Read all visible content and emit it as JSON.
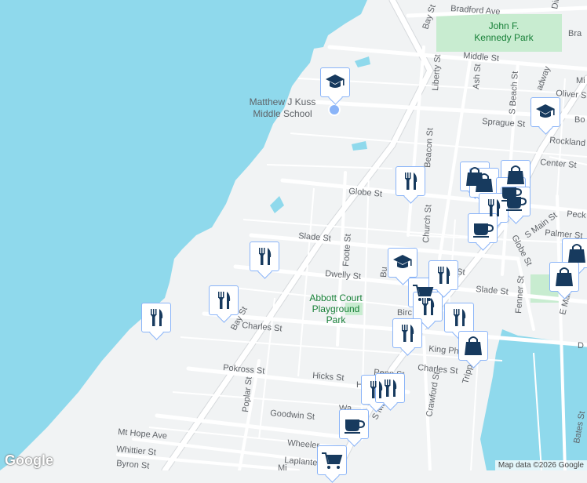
{
  "map": {
    "colors": {
      "water": "#8fd9ec",
      "land": "#f1f3f4",
      "park": "#c8ecd0",
      "road": "#ffffff",
      "road_casing": "#d6d9dc",
      "marker_icon": "#173a5e",
      "school_label": "#5f6368",
      "park_label": "#188038"
    },
    "streets": {
      "bradford_ave": "Bradford Ave",
      "bay_st_top": "Bay St",
      "middle_st": "Middle St",
      "sprague_st": "Sprague St",
      "globe_st": "Globe St",
      "slade_st": "Slade St",
      "dwelly_st": "Dwelly St",
      "charles_st": "Charles St",
      "bay_st_bottom": "Bay St",
      "pokross_st": "Pokross St",
      "hicks_st": "Hicks St",
      "goodwin_st": "Goodwin St",
      "mt_hope_ave": "Mt Hope Ave",
      "whittier_st": "Whittier St",
      "byron_st": "Byron St",
      "wheeler": "Wheeler",
      "laplante": "Laplante",
      "poplar_st": "Poplar St",
      "foote_st": "Foote St",
      "liberty_st": "Liberty St",
      "beacon_st": "Beacon St",
      "church_st": "Church St",
      "ash_st": "Ash St",
      "s_beach_st": "S Beach St",
      "oliver_st": "Oliver St",
      "rockland_st": "Rockland St",
      "center_st": "Center St",
      "peck": "Peck",
      "palmer_st": "Palmer St",
      "s_main_st_upper": "S Main St",
      "globe_st_east": "Globe St",
      "hall_st": "Hall St",
      "slade_st_east": "Slade St",
      "fenner_st": "Fenner St",
      "e_main_st": "E Main St",
      "king_phil": "King Phil",
      "birc": "Birc",
      "charles_st_east": "Charles St",
      "penn_st": "Penn St",
      "crawford_st": "Crawford St",
      "tripp_st": "Tripp St",
      "bates_st": "Bates St",
      "s_main_lower": "S Ma",
      "mi_right": "Mi",
      "broadway": "adway",
      "dim": "Dim",
      "bra": "Bra",
      "bo": "Bo",
      "d_right": "D",
      "bu": "Bu",
      "w": "Wa",
      "h": "H",
      "l": "L",
      "mi_bottom": "Mi",
      "pi": "Pi"
    },
    "pois": {
      "jfk_park": [
        "John F.",
        "Kennedy Park"
      ],
      "school": [
        "Matthew J Kuss",
        "Middle School"
      ],
      "abbott_park": [
        "Abbott Court",
        "Playground",
        "Park"
      ]
    },
    "markers": [
      {
        "icon": "school-icon"
      },
      {
        "icon": "school-icon"
      },
      {
        "icon": "restaurant-icon"
      },
      {
        "icon": "restaurant-icon"
      },
      {
        "icon": "restaurant-icon"
      },
      {
        "icon": "shopping-bag-icon"
      },
      {
        "icon": "shopping-bag-icon"
      },
      {
        "icon": "shopping-bag-icon"
      },
      {
        "icon": "coffee-icon"
      },
      {
        "icon": "coffee-icon"
      },
      {
        "icon": "restaurant-icon"
      },
      {
        "icon": "coffee-icon"
      },
      {
        "icon": "school-icon"
      },
      {
        "icon": "shopping-bag-icon"
      },
      {
        "icon": "shopping-bag-icon"
      },
      {
        "icon": "grocery-cart-icon"
      },
      {
        "icon": "restaurant-icon"
      },
      {
        "icon": "restaurant-icon"
      },
      {
        "icon": "restaurant-icon"
      },
      {
        "icon": "shopping-bag-icon"
      },
      {
        "icon": "restaurant-icon"
      },
      {
        "icon": "restaurant-icon"
      },
      {
        "icon": "coffee-icon"
      },
      {
        "icon": "grocery-cart-icon"
      },
      {
        "icon": "restaurant-icon"
      },
      {
        "icon": "restaurant-icon"
      }
    ]
  },
  "footer": {
    "logo": "Google",
    "attribution": "Map data ©2026 Google"
  }
}
